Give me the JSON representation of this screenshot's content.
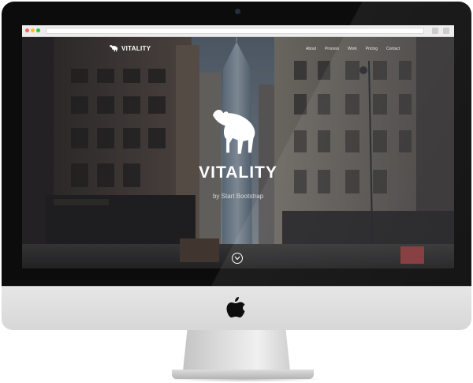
{
  "brand": {
    "name": "VITALITY",
    "icon": "bull-icon"
  },
  "nav": {
    "items": [
      {
        "label": "About"
      },
      {
        "label": "Process"
      },
      {
        "label": "Work"
      },
      {
        "label": "Pricing"
      },
      {
        "label": "Contact"
      }
    ]
  },
  "hero": {
    "title": "VITALITY",
    "subtitle": "by Start Bootstrap",
    "logo_icon": "bull-icon",
    "scroll_icon": "chevron-down-icon"
  },
  "colors": {
    "bezel": "#0c0c0c",
    "chin": "#e0e0e0",
    "hero_text": "#ffffff",
    "overlay": "#2b3138"
  }
}
